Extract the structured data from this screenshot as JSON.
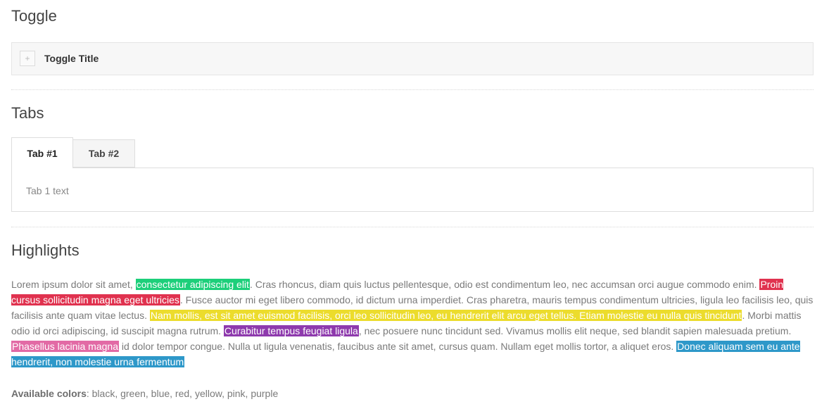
{
  "toggle_section": {
    "title": "Toggle",
    "toggle_title": "Toggle Title",
    "toggle_icon": "+"
  },
  "tabs_section": {
    "title": "Tabs",
    "tabs": [
      {
        "label": "Tab #1"
      },
      {
        "label": "Tab #2"
      }
    ],
    "panel_text": "Tab 1 text"
  },
  "highlights_section": {
    "title": "Highlights",
    "text": {
      "t1": "Lorem ipsum dolor sit amet, ",
      "h1": "consectetur adipiscing elit",
      "t2": ". Cras rhoncus, diam quis luctus pellentesque, odio est condimentum leo, nec accumsan orci augue commodo enim. ",
      "h2": "Proin cursus sollicitudin magna eget ultricies",
      "t3": ". Fusce auctor mi eget libero commodo, id dictum urna imperdiet. Cras pharetra, mauris tempus condimentum ultricies, ligula leo facilisis leo, quis facilisis ante quam vitae lectus. ",
      "h3": "Nam mollis, est sit amet euismod facilisis, orci leo sollicitudin leo, eu hendrerit elit arcu eget tellus. Etiam molestie eu nulla quis tincidunt",
      "t4": ". Morbi mattis odio id orci adipiscing, id suscipit magna rutrum. ",
      "h4": "Curabitur tempus feugiat ligula",
      "t5": ", nec posuere nunc tincidunt sed. Vivamus mollis elit neque, sed blandit sapien malesuada pretium. ",
      "h5": "Phasellus lacinia magna",
      "t6": " id dolor tempor congue. Nulla ut ligula venenatis, faucibus ante sit amet, cursus quam. Nullam eget mollis tortor, a aliquet eros. ",
      "h6": "Donec aliquam sem eu ante hendrerit, non molestie urna fermentum"
    },
    "colors_label": "Available colors",
    "colors_list": ": black, green, blue, red, yellow, pink, purple"
  },
  "highlight_colors": {
    "green": "#1ccf7a",
    "red": "#e0324f",
    "yellow": "#ecdc2c",
    "purple": "#8e3aad",
    "pink": "#e26aa5",
    "blue": "#2e98c9"
  }
}
